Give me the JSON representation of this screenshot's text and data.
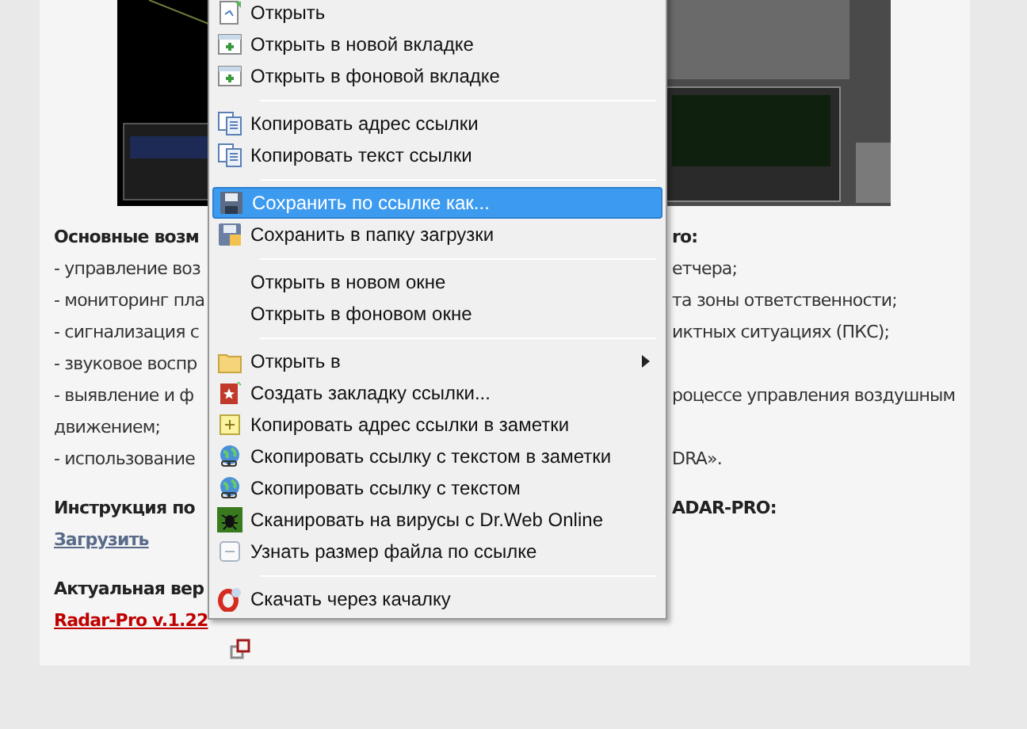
{
  "article": {
    "lines": [
      {
        "kind": "heading",
        "left": "Основные возм",
        "right": "ro:"
      },
      {
        "kind": "text",
        "left": "- управление воз",
        "right": "етчера;"
      },
      {
        "kind": "text",
        "left": "- мониторинг пла",
        "right": "та зоны ответственности;"
      },
      {
        "kind": "text",
        "left": "- сигнализация с",
        "right": "иктных ситуациях (ПКС);"
      },
      {
        "kind": "text",
        "left": "- звуковое воспр"
      },
      {
        "kind": "text",
        "left": "- выявление и ф",
        "right": "роцессе управления воздушным"
      },
      {
        "kind": "text",
        "left": "движением;"
      },
      {
        "kind": "text",
        "left": "- использование",
        "right": "DRA»."
      },
      {
        "kind": "heading",
        "left": "Инструкция по",
        "right": "ADAR-PRO:"
      },
      {
        "kind": "link",
        "left": "Загрузить"
      },
      {
        "kind": "heading",
        "left": "Актуальная вер"
      },
      {
        "kind": "download",
        "left": "Radar-Pro v.1.22"
      }
    ]
  },
  "context_menu": {
    "items": [
      {
        "kind": "item",
        "label": "Открыть",
        "selected": false
      },
      {
        "kind": "item",
        "label": "Открыть в новой вкладке",
        "selected": false
      },
      {
        "kind": "item",
        "label": "Открыть в фоновой вкладке",
        "selected": false
      },
      {
        "kind": "separator"
      },
      {
        "kind": "item",
        "label": "Копировать адрес ссылки",
        "selected": false
      },
      {
        "kind": "item",
        "label": "Копировать текст ссылки",
        "selected": false
      },
      {
        "kind": "separator"
      },
      {
        "kind": "item",
        "label": "Сохранить по ссылке как...",
        "selected": true
      },
      {
        "kind": "item",
        "label": "Сохранить в папку загрузки",
        "selected": false
      },
      {
        "kind": "separator"
      },
      {
        "kind": "item",
        "label": "Открыть в новом окне",
        "selected": false
      },
      {
        "kind": "item",
        "label": "Открыть в фоновом окне",
        "selected": false
      },
      {
        "kind": "separator"
      },
      {
        "kind": "submenu",
        "label": "Открыть в",
        "selected": false
      },
      {
        "kind": "item",
        "label": "Создать закладку ссылки...",
        "selected": false
      },
      {
        "kind": "item",
        "label": "Копировать адрес ссылки в заметки",
        "selected": false
      },
      {
        "kind": "item",
        "label": "Скопировать ссылку с текстом в заметки",
        "selected": false
      },
      {
        "kind": "item",
        "label": "Скопировать ссылку с текстом",
        "selected": false
      },
      {
        "kind": "item",
        "label": "Сканировать на вирусы с Dr.Web Online",
        "selected": false
      },
      {
        "kind": "item",
        "label": "Узнать размер файла по ссылке",
        "selected": false
      },
      {
        "kind": "separator"
      },
      {
        "kind": "item",
        "label": "Скачать через качалку",
        "selected": false
      }
    ]
  }
}
